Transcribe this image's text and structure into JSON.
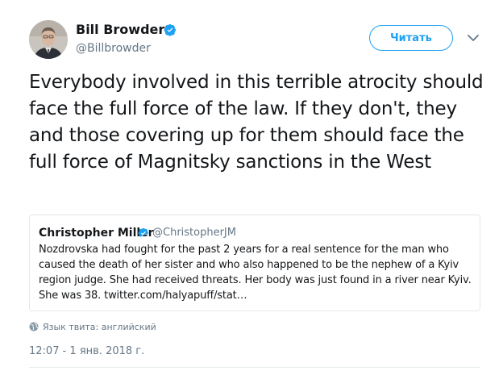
{
  "author": {
    "name": "Bill Browder",
    "handle": "@Billbrowder",
    "verified": true,
    "avatar_icon": "avatar-icon"
  },
  "actions": {
    "follow_label": "Читать",
    "menu_icon": "chevron-down-icon"
  },
  "tweet": {
    "text": "Everybody involved in this terrible atrocity should face the full force of the law. If they don't, they and those covering up for them should face the full force of Magnitsky sanctions in the West"
  },
  "quote": {
    "author_name": "Christopher Miller",
    "author_handle": "@ChristopherJM",
    "verified": true,
    "text": "Nozdrovska had fought for the past 2 years for a real sentence for the man who caused the death of her sister and who also happened to be the nephew of a Kyiv region judge. She had received threats. Her body was just found in a river near Kyiv. She was 38. twitter.com/halyapuff/stat…"
  },
  "meta": {
    "language": "Язык твита: английский",
    "timestamp": "12:07 - 1 янв. 2018 г."
  },
  "colors": {
    "accent": "#1da1f2",
    "text_primary": "#14171a",
    "text_secondary": "#657786",
    "border": "#e1e8ed"
  }
}
